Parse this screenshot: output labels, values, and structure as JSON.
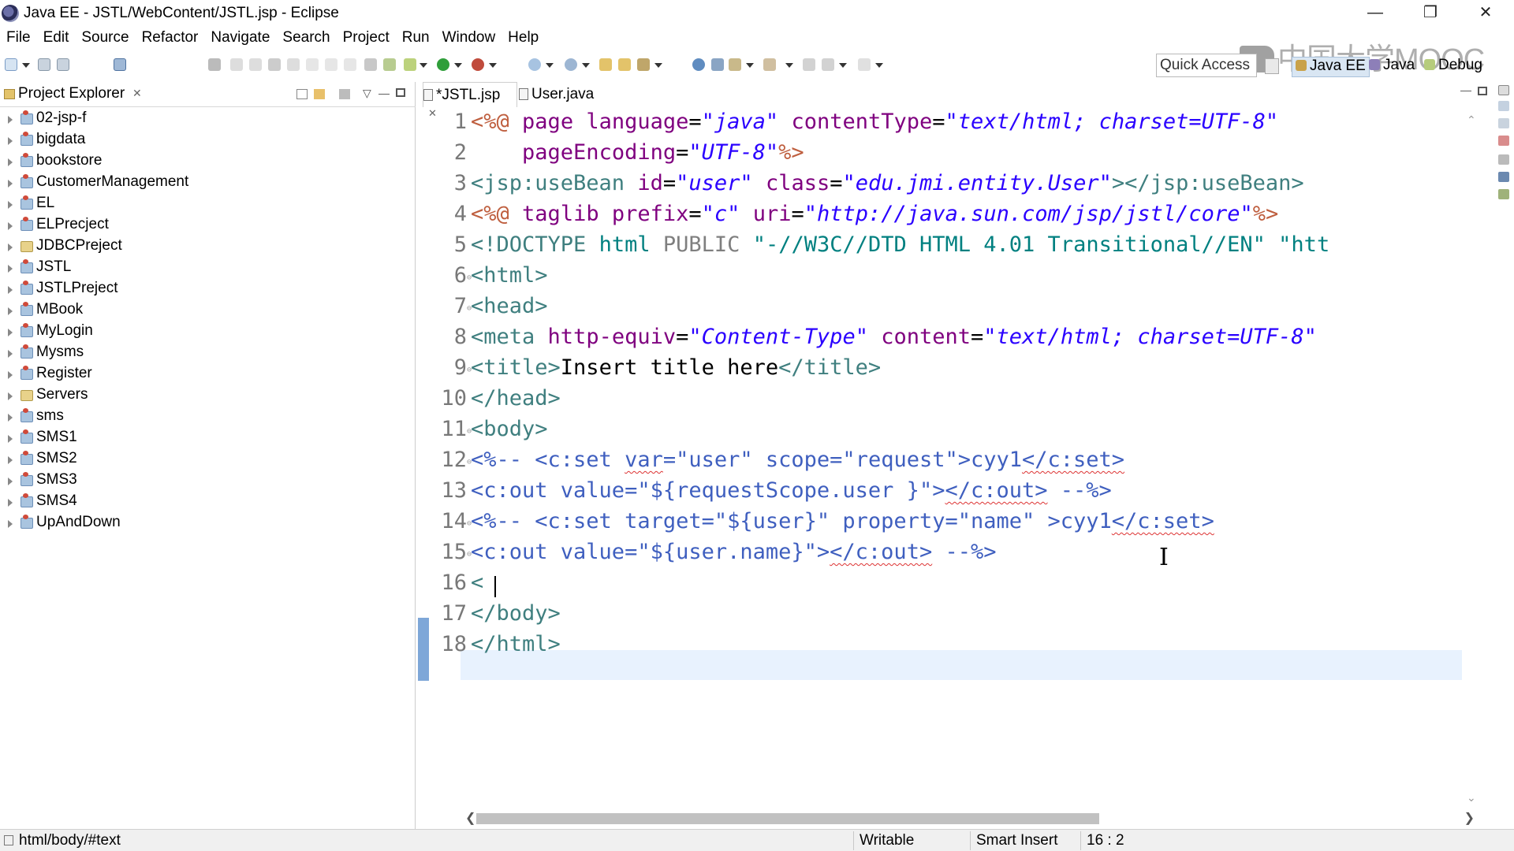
{
  "window": {
    "title": "Java EE - JSTL/WebContent/JSTL.jsp - Eclipse"
  },
  "menubar": {
    "items": [
      "File",
      "Edit",
      "Source",
      "Refactor",
      "Navigate",
      "Search",
      "Project",
      "Run",
      "Window",
      "Help"
    ]
  },
  "toolbar": {
    "quick_access_placeholder": "Quick Access",
    "perspectives": [
      "Java EE",
      "Java",
      "Debug"
    ],
    "watermark": "中国大学MOOC"
  },
  "explorer": {
    "title": "Project Explorer",
    "projects": [
      "02-jsp-f",
      "bigdata",
      "bookstore",
      "CustomerManagement",
      "EL",
      "ELPrecject",
      "JDBCPreject",
      "JSTL",
      "JSTLPreject",
      "MBook",
      "MyLogin",
      "Mysms",
      "Register",
      "Servers",
      "sms",
      "SMS1",
      "SMS2",
      "SMS3",
      "SMS4",
      "UpAndDown"
    ]
  },
  "editor": {
    "tabs": [
      {
        "label": "*JSTL.jsp",
        "active": true
      },
      {
        "label": "User.java",
        "active": false
      }
    ],
    "line_numbers": [
      "1",
      "2",
      "3",
      "4",
      "5",
      "6",
      "7",
      "8",
      "9",
      "10",
      "11",
      "12",
      "13",
      "14",
      "15",
      "16",
      "17",
      "18"
    ],
    "lines": [
      [
        [
          "t-del",
          "<%@"
        ],
        [
          "t-txt",
          " "
        ],
        [
          "t-attr",
          "page"
        ],
        [
          "t-txt",
          " "
        ],
        [
          "t-attr",
          "language"
        ],
        [
          "t-txt",
          "="
        ],
        [
          "t-val",
          "\"java\""
        ],
        [
          "t-txt",
          " "
        ],
        [
          "t-attr",
          "contentType"
        ],
        [
          "t-txt",
          "="
        ],
        [
          "t-val",
          "\"text/html; charset=UTF-8\""
        ]
      ],
      [
        [
          "t-txt",
          "    "
        ],
        [
          "t-attr",
          "pageEncoding"
        ],
        [
          "t-txt",
          "="
        ],
        [
          "t-val",
          "\"UTF-8\""
        ],
        [
          "t-del",
          "%>"
        ]
      ],
      [
        [
          "t-tag",
          "<jsp:useBean"
        ],
        [
          "t-txt",
          " "
        ],
        [
          "t-attr",
          "id"
        ],
        [
          "t-txt",
          "="
        ],
        [
          "t-val",
          "\"user\""
        ],
        [
          "t-txt",
          " "
        ],
        [
          "t-attr",
          "class"
        ],
        [
          "t-txt",
          "="
        ],
        [
          "t-val",
          "\"edu.jmi.entity.User\""
        ],
        [
          "t-tag",
          "></jsp:useBean>"
        ]
      ],
      [
        [
          "t-del",
          "<%@"
        ],
        [
          "t-txt",
          " "
        ],
        [
          "t-attr",
          "taglib"
        ],
        [
          "t-txt",
          " "
        ],
        [
          "t-attr",
          "prefix"
        ],
        [
          "t-txt",
          "="
        ],
        [
          "t-val",
          "\"c\""
        ],
        [
          "t-txt",
          " "
        ],
        [
          "t-attr",
          "uri"
        ],
        [
          "t-txt",
          "="
        ],
        [
          "t-val",
          "\"http://java.sun.com/jsp/jstl/core\""
        ],
        [
          "t-del",
          "%>"
        ]
      ],
      [
        [
          "t-tag",
          "<!DOCTYPE"
        ],
        [
          "t-txt",
          " "
        ],
        [
          "t-doc",
          "html"
        ],
        [
          "t-txt",
          " "
        ],
        [
          "t-gray",
          "PUBLIC"
        ],
        [
          "t-txt",
          " "
        ],
        [
          "t-doc",
          "\"-//W3C//DTD HTML 4.01 Transitional//EN\""
        ],
        [
          "t-txt",
          " "
        ],
        [
          "t-doc",
          "\"htt"
        ]
      ],
      [
        [
          "t-tag",
          "<html>"
        ]
      ],
      [
        [
          "t-tag",
          "<head>"
        ]
      ],
      [
        [
          "t-tag",
          "<meta"
        ],
        [
          "t-txt",
          " "
        ],
        [
          "t-attr",
          "http-equiv"
        ],
        [
          "t-txt",
          "="
        ],
        [
          "t-val",
          "\"Content-Type\""
        ],
        [
          "t-txt",
          " "
        ],
        [
          "t-attr",
          "content"
        ],
        [
          "t-txt",
          "="
        ],
        [
          "t-val",
          "\"text/html; charset=UTF-8\""
        ]
      ],
      [
        [
          "t-tag",
          "<title>"
        ],
        [
          "t-txt",
          "Insert title here"
        ],
        [
          "t-tag",
          "</title>"
        ]
      ],
      [
        [
          "t-tag",
          "</head>"
        ]
      ],
      [
        [
          "t-tag",
          "<body>"
        ]
      ],
      [
        [
          "t-cmt",
          "<%-- <c:set "
        ],
        [
          "t-cmt squig",
          "var"
        ],
        [
          "t-cmt",
          "=\"user\" scope=\"request\">cyy1"
        ],
        [
          "t-cmt squig",
          "</c:set>"
        ]
      ],
      [
        [
          "t-cmt",
          "<c:out value=\"${requestScope.user }\">"
        ],
        [
          "t-cmt squig",
          "</c:out>"
        ],
        [
          "t-cmt",
          " --%>"
        ]
      ],
      [
        [
          "t-cmt",
          "<%-- <c:set target=\"${user}\" property=\"name\" >cyy1"
        ],
        [
          "t-cmt squig",
          "</c:set>"
        ]
      ],
      [
        [
          "t-cmt",
          "<c:out value=\"${user.name}\">"
        ],
        [
          "t-cmt squig",
          "</c:out>"
        ],
        [
          "t-cmt",
          " --%>"
        ]
      ],
      [
        [
          "t-tag",
          "<"
        ]
      ],
      [
        [
          "t-tag",
          "</body>"
        ]
      ],
      [
        [
          "t-tag",
          "</html>"
        ]
      ]
    ],
    "fold_lines": [
      6,
      7,
      9,
      11,
      12,
      14,
      15
    ]
  },
  "statusbar": {
    "path": "html/body/#text",
    "writable": "Writable",
    "insert_mode": "Smart Insert",
    "position": "16 : 2"
  }
}
